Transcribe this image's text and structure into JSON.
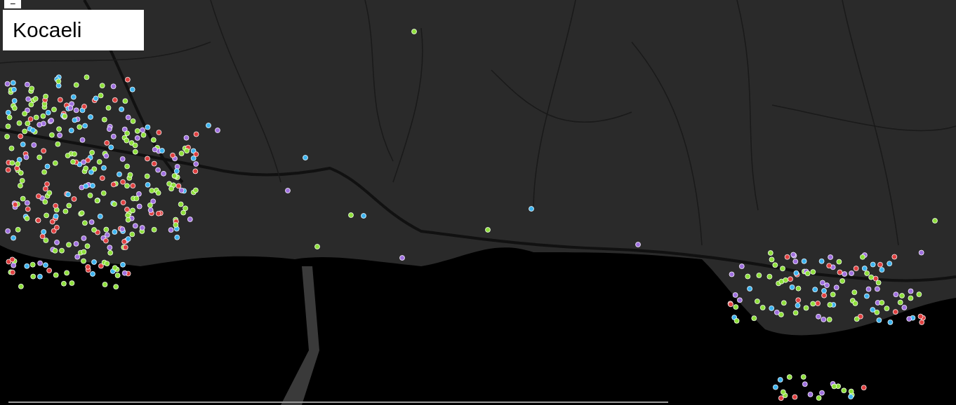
{
  "map": {
    "zoom_out_button": "−",
    "title": "Kocaeli"
  }
}
